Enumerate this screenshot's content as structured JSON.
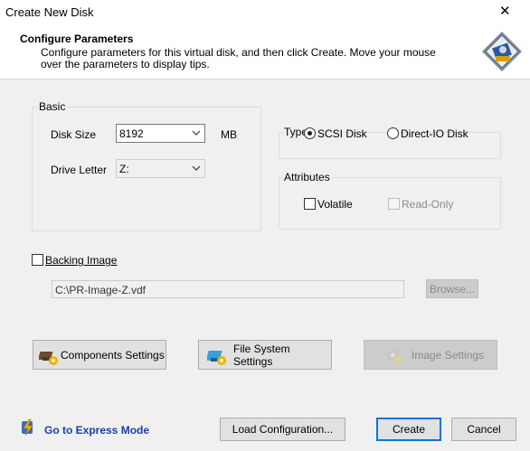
{
  "window": {
    "title": "Create New Disk",
    "close_glyph": "✕"
  },
  "header": {
    "title": "Configure Parameters",
    "description": "Configure parameters for this virtual disk, and then click Create. Move your mouse over the parameters to display tips.",
    "logo_icon": "virtual-disk-logo-icon"
  },
  "basic": {
    "legend": "Basic",
    "disk_size_label": "Disk Size",
    "disk_size_value": "8192",
    "disk_size_unit": "MB",
    "drive_letter_label": "Drive Letter",
    "drive_letter_value": "Z:"
  },
  "type": {
    "legend": "Type",
    "options": [
      {
        "label": "SCSI Disk",
        "selected": true
      },
      {
        "label": "Direct-IO Disk",
        "selected": false
      }
    ]
  },
  "attributes": {
    "legend": "Attributes",
    "volatile_label": "Volatile",
    "volatile_checked": false,
    "readonly_label": "Read-Only",
    "readonly_checked": false
  },
  "backing": {
    "label": "Backing Image",
    "checked": false,
    "path": "C:\\PR-Image-Z.vdf",
    "browse_label": "Browse..."
  },
  "settings": {
    "components": "Components Settings",
    "file_system": "File System Settings",
    "image": "Image Settings"
  },
  "footer": {
    "express_mode": "Go to Express Mode",
    "load_config": "Load Configuration...",
    "create": "Create",
    "cancel": "Cancel"
  },
  "colors": {
    "accent": "#0078d7",
    "link": "#1a3ea8"
  }
}
